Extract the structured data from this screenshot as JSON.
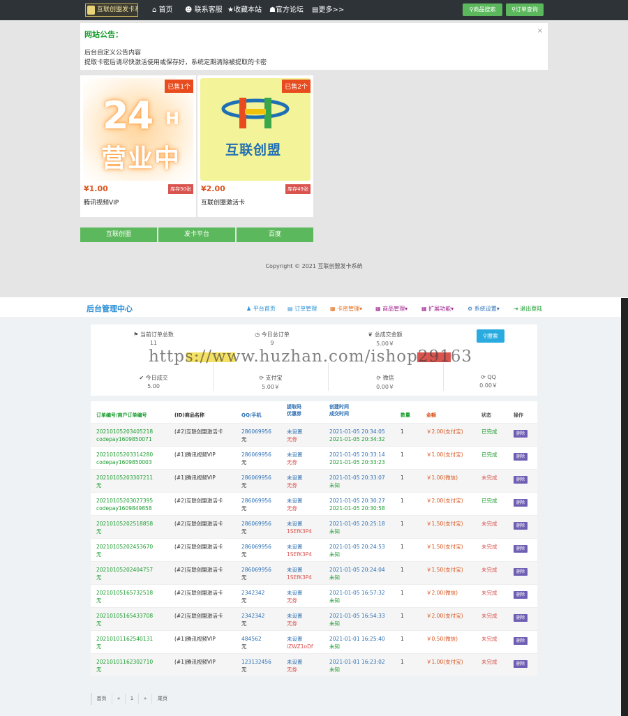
{
  "nav": {
    "logo": "互联创盟发卡系统",
    "items": [
      "首页",
      "联系客服",
      "收藏本站",
      "官方论坛",
      "更多>>"
    ],
    "btn_search": "商品搜索",
    "btn_order": "订单查询"
  },
  "notice": {
    "title": "网站公告：",
    "close": "×",
    "line1": "后台自定义公告内容",
    "line2": "提取卡密后请尽快激活使用或保存好，系统定期清除被提取的卡密"
  },
  "products": [
    {
      "sold": "已售1个",
      "img_text1": "24",
      "img_text2": "H",
      "img_text3": "营业中",
      "price": "¥1.00",
      "stock": "库存50张",
      "name": "腾讯视频VIP"
    },
    {
      "sold": "已售2个",
      "img_text1": "H",
      "img_text2": "互联创盟",
      "price": "¥2.00",
      "stock": "库存49张",
      "name": "互联创盟激活卡"
    }
  ],
  "links": [
    "互联创盟",
    "发卡平台",
    "百度"
  ],
  "copyright": "Copyright © 2021 互联创盟发卡系统",
  "admin": {
    "title": "后台管理中心",
    "nav": [
      "平台首页",
      "订单管理",
      "卡密管理▾",
      "商品管理▾",
      "扩展功能▾",
      "系统设置▾",
      "退出登陆"
    ],
    "stats": [
      {
        "label": "当前订单总数",
        "value": "11"
      },
      {
        "label": "今日总订单",
        "value": "9"
      },
      {
        "label": "总成交金额",
        "value": "5.00￥"
      },
      {
        "label": "今日成交",
        "value": "5.00"
      },
      {
        "label": "支付宝",
        "value": "5.00￥"
      },
      {
        "label": "微信",
        "value": "0.00￥"
      },
      {
        "label": "QQ",
        "value": "0.00￥"
      }
    ],
    "search": "搜索",
    "watermark": "https://www.huzhan.com/ishop29163",
    "headers": [
      "订单编号/商户订单编号",
      "(ID)商品名称",
      "QQ/手机",
      "提取码\n优惠券",
      "创建时间\n成交时间",
      "数量",
      "金额",
      "状态",
      "操作"
    ],
    "rows": [
      {
        "order": "20210105203405218",
        "merchant": "codepay1609850071",
        "product": "(#2)互联创盟激活卡",
        "qq": "286069956",
        "qq2": "无",
        "code": "未设置",
        "coupon": "无券",
        "created": "2021-01-05 20:34:05",
        "paid": "2021-01-05 20:34:32",
        "qty": "1",
        "amount": "￥2.00(支付宝)",
        "status": "已完成"
      },
      {
        "order": "20210105203314280",
        "merchant": "codepay1609850003",
        "product": "(#1)腾讯视频VIP",
        "qq": "286069956",
        "qq2": "无",
        "code": "未设置",
        "coupon": "无券",
        "created": "2021-01-05 20:33:14",
        "paid": "2021-01-05 20:33:23",
        "qty": "1",
        "amount": "￥1.00(支付宝)",
        "status": "已完成"
      },
      {
        "order": "20210105203307211",
        "merchant": "无",
        "product": "(#1)腾讯视频VIP",
        "qq": "286069956",
        "qq2": "无",
        "code": "未设置",
        "coupon": "无券",
        "created": "2021-01-05 20:33:07",
        "paid": "未知",
        "qty": "1",
        "amount": "￥1.00(微信)",
        "status": "未完成"
      },
      {
        "order": "20210105203027395",
        "merchant": "codepay1609849858",
        "product": "(#2)互联创盟激活卡",
        "qq": "286069956",
        "qq2": "无",
        "code": "未设置",
        "coupon": "无券",
        "created": "2021-01-05 20:30:27",
        "paid": "2021-01-05 20:30:58",
        "qty": "1",
        "amount": "￥2.00(支付宝)",
        "status": "已完成"
      },
      {
        "order": "20210105202518858",
        "merchant": "无",
        "product": "(#2)互联创盟激活卡",
        "qq": "286069956",
        "qq2": "无",
        "code": "未设置",
        "coupon": "1SEfK3P4",
        "created": "2021-01-05 20:25:18",
        "paid": "未知",
        "qty": "1",
        "amount": "￥1.50(支付宝)",
        "status": "未完成"
      },
      {
        "order": "20210105202453670",
        "merchant": "无",
        "product": "(#2)互联创盟激活卡",
        "qq": "286069956",
        "qq2": "无",
        "code": "未设置",
        "coupon": "1SEfK3P4",
        "created": "2021-01-05 20:24:53",
        "paid": "未知",
        "qty": "1",
        "amount": "￥1.50(支付宝)",
        "status": "未完成"
      },
      {
        "order": "20210105202404757",
        "merchant": "无",
        "product": "(#2)互联创盟激活卡",
        "qq": "286069956",
        "qq2": "无",
        "code": "未设置",
        "coupon": "1SEfK3P4",
        "created": "2021-01-05 20:24:04",
        "paid": "未知",
        "qty": "1",
        "amount": "￥1.50(支付宝)",
        "status": "未完成"
      },
      {
        "order": "20210105165732518",
        "merchant": "无",
        "product": "(#2)互联创盟激活卡",
        "qq": "2342342",
        "qq2": "无",
        "code": "未设置",
        "coupon": "无券",
        "created": "2021-01-05 16:57:32",
        "paid": "未知",
        "qty": "1",
        "amount": "￥2.00(微信)",
        "status": "未完成"
      },
      {
        "order": "20210105165433708",
        "merchant": "无",
        "product": "(#2)互联创盟激活卡",
        "qq": "2342342",
        "qq2": "无",
        "code": "未设置",
        "coupon": "无券",
        "created": "2021-01-05 16:54:33",
        "paid": "未知",
        "qty": "1",
        "amount": "￥2.00(支付宝)",
        "status": "未完成"
      },
      {
        "order": "20210101162540131",
        "merchant": "无",
        "product": "(#1)腾讯视频VIP",
        "qq": "484562",
        "qq2": "无",
        "code": "未设置",
        "coupon": "iZWZ1oDf",
        "created": "2021-01-01 16:25:40",
        "paid": "未知",
        "qty": "1",
        "amount": "￥0.50(微信)",
        "status": "未完成"
      },
      {
        "order": "20210101162302710",
        "merchant": "无",
        "product": "(#1)腾讯视频VIP",
        "qq": "123132456",
        "qq2": "无",
        "code": "未设置",
        "coupon": "无券",
        "created": "2021-01-01 16:23:02",
        "paid": "未知",
        "qty": "1",
        "amount": "￥1.00(支付宝)",
        "status": "未完成"
      }
    ],
    "delete": "删除",
    "pager": [
      "首页",
      "«",
      "1",
      "»",
      "尾页"
    ]
  },
  "colors": {
    "green": "#5cb85c",
    "orange": "#e84c1e",
    "blue": "#29abe0",
    "purple": "#6f5fb4",
    "red": "#d9534f",
    "done": "#1a9c2e"
  }
}
